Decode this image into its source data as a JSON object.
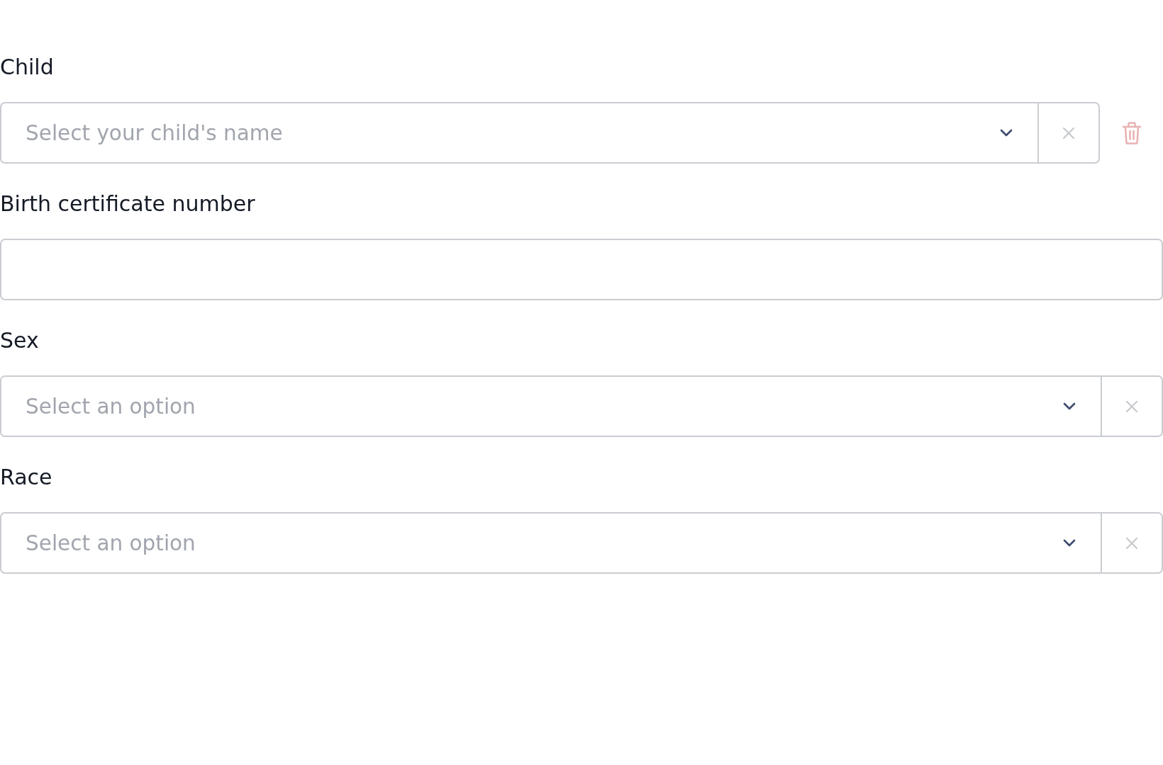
{
  "fields": [
    {
      "kind": "select",
      "label": "Child",
      "placeholder": "Select your child's name",
      "removable": true
    },
    {
      "kind": "text",
      "label": "Birth certificate number",
      "removable": false
    },
    {
      "kind": "select",
      "label": "Sex",
      "placeholder": "Select an option",
      "removable": false
    },
    {
      "kind": "select",
      "label": "Race",
      "placeholder": "Select an option",
      "removable": false
    }
  ]
}
